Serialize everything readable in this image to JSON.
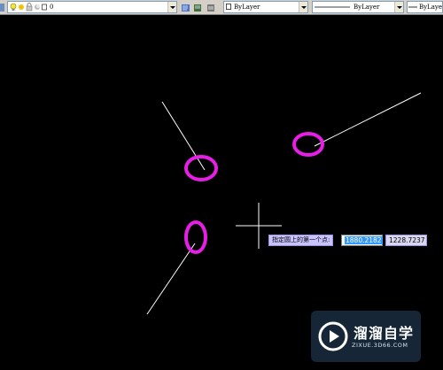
{
  "toolbar": {
    "layer_value": "0",
    "color_value": "ByLayer",
    "linetype_value": "ByLayer",
    "lineweight_value": "ByLayer"
  },
  "prompt": {
    "text": "指定圆上的第一个点:",
    "x_value": "1880.2182",
    "y_value": "1228.7237"
  },
  "watermark": {
    "title": "溜溜自学",
    "url": "ZIXUE.3D66.COM"
  },
  "colors": {
    "background": "#000000",
    "highlight_ellipse": "#e61ee6",
    "line": "#ffffff",
    "tooltip_bg": "#c8c4ff",
    "selected_input": "#3399ff"
  },
  "icons": [
    "layer-state-icon",
    "lightbulb-icon",
    "sun-icon",
    "lock-icon",
    "layer-color-icon",
    "layer-previous-icon",
    "layer-manager-icon",
    "color-swatch-icon",
    "dropdown-arrow-icon",
    "crosshair-cursor-icon",
    "play-logo-icon"
  ]
}
